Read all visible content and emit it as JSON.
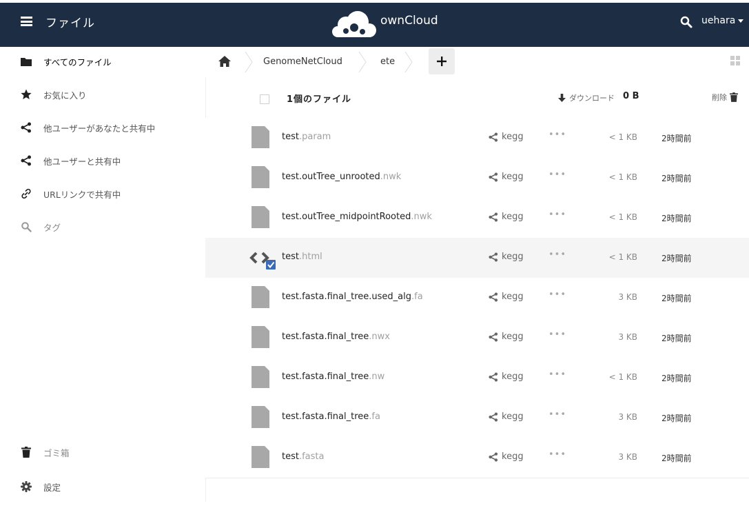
{
  "header": {
    "app_name": "ファイル",
    "brand": "ownCloud",
    "username": "uehara",
    "bg_color": "#1d2d44"
  },
  "sidebar": {
    "items": [
      {
        "label": "すべてのファイル",
        "icon": "folder-icon"
      },
      {
        "label": "お気に入り",
        "icon": "star-icon"
      },
      {
        "label": "他ユーザーがあなたと共有中",
        "icon": "share-icon"
      },
      {
        "label": "他ユーザーと共有中",
        "icon": "share-icon"
      },
      {
        "label": "URLリンクで共有中",
        "icon": "link-icon"
      },
      {
        "label": "タグ",
        "icon": "tag-search-icon"
      }
    ],
    "bottom": [
      {
        "label": "ゴミ箱",
        "icon": "trash-icon"
      },
      {
        "label": "設定",
        "icon": "gear-icon"
      }
    ]
  },
  "breadcrumb": {
    "items": [
      "GenomeNetCloud",
      "ete"
    ],
    "add_label": "+"
  },
  "file_list": {
    "count_label": "1個のファイル",
    "download_label": "ダウンロード",
    "selected_size": "0 B",
    "delete_label": "削除",
    "rows": [
      {
        "base": "test",
        "ext": ".param",
        "owner": "kegg",
        "more": "•••",
        "size": "< 1 KB",
        "modified": "2時間前"
      },
      {
        "base": "test.outTree_unrooted",
        "ext": ".nwk",
        "owner": "kegg",
        "more": "•••",
        "size": "< 1 KB",
        "modified": "2時間前"
      },
      {
        "base": "test.outTree_midpointRooted",
        "ext": ".nwk",
        "owner": "kegg",
        "more": "•••",
        "size": "< 1 KB",
        "modified": "2時間前"
      },
      {
        "base": "test",
        "ext": ".html",
        "owner": "kegg",
        "more": "•••",
        "size": "< 1 KB",
        "modified": "2時間前",
        "selected": true
      },
      {
        "base": "test.fasta.final_tree.used_alg",
        "ext": ".fa",
        "owner": "kegg",
        "more": "•••",
        "size": "3 KB",
        "modified": "2時間前"
      },
      {
        "base": "test.fasta.final_tree",
        "ext": ".nwx",
        "owner": "kegg",
        "more": "•••",
        "size": "3 KB",
        "modified": "2時間前"
      },
      {
        "base": "test.fasta.final_tree",
        "ext": ".nw",
        "owner": "kegg",
        "more": "•••",
        "size": "< 1 KB",
        "modified": "2時間前"
      },
      {
        "base": "test.fasta.final_tree",
        "ext": ".fa",
        "owner": "kegg",
        "more": "•••",
        "size": "3 KB",
        "modified": "2時間前"
      },
      {
        "base": "test",
        "ext": ".fasta",
        "owner": "kegg",
        "more": "•••",
        "size": "3 KB",
        "modified": "2時間前"
      }
    ]
  }
}
